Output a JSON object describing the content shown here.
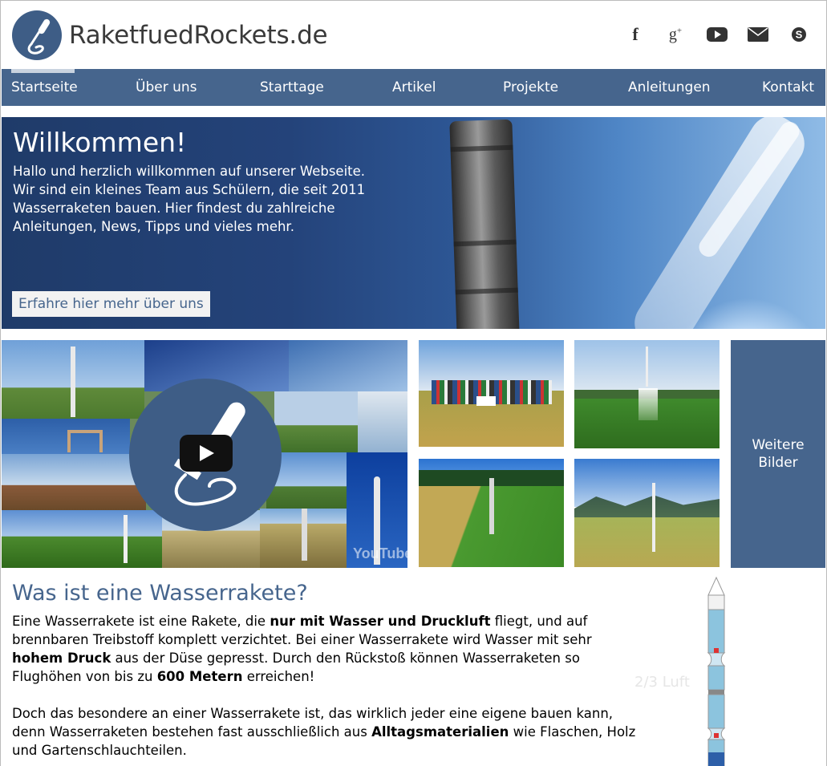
{
  "header": {
    "site_title": "RaketfuedRockets.de",
    "social": [
      {
        "name": "facebook-icon",
        "glyph": "f"
      },
      {
        "name": "google-plus-icon",
        "glyph": "g+"
      },
      {
        "name": "youtube-icon",
        "glyph": ""
      },
      {
        "name": "mail-icon",
        "glyph": ""
      },
      {
        "name": "skype-icon",
        "glyph": "s"
      }
    ]
  },
  "nav": {
    "items": [
      "Startseite",
      "Über uns",
      "Starttage",
      "Artikel",
      "Projekte",
      "Anleitungen",
      "Kontakt"
    ],
    "active": "Startseite"
  },
  "hero": {
    "title": "Willkommen!",
    "text": "Hallo und herzlich willkommen auf unserer Webseite. Wir sind ein kleines Team aus Schülern, die seit 2011 Wasserraketen bauen. Hier findest du zahlreiche Anleitungen, News, Tipps und vieles mehr.",
    "button": "Erfahre hier mehr über uns"
  },
  "gallery": {
    "youtube_logo": "YouTube",
    "more_label_line1": "Weitere",
    "more_label_line2": "Bilder"
  },
  "article": {
    "title": "Was ist eine Wasserrakete?",
    "p1_a": "Eine Wasserrakete ist eine Rakete, die ",
    "p1_b": "nur mit Wasser und Druckluft",
    "p1_c": " fliegt, und auf brennbaren Treibstoff komplett verzichtet. Bei einer Wasserrakete wird Wasser mit sehr ",
    "p1_d": "hohem Druck",
    "p1_e": " aus der Düse gepresst. Durch den Rückstoß können Wasserraketen so Flughöhen von bis zu ",
    "p1_f": "600 Metern",
    "p1_g": " erreichen!",
    "p2_a": "Doch das besondere an einer Wasserrakete ist, das wirklich jeder eine eigene bauen kann, denn Wasserraketen bestehen fast ausschließlich aus ",
    "p2_b": "Alltagsmaterialien",
    "p2_c": " wie Flaschen, Holz und Gartenschlauchteilen.",
    "diagram_label": "2/3 Luft"
  },
  "colors": {
    "brand_blue": "#46658d",
    "logo_blue": "#3e5d86"
  }
}
